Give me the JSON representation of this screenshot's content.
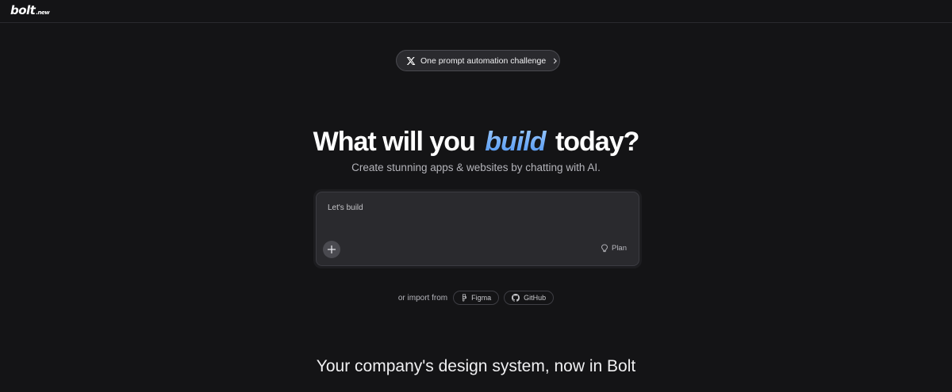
{
  "header": {
    "logo_text": "bolt",
    "logo_suffix": ".new"
  },
  "announcement": {
    "icon": "x-logo-icon",
    "label": "One prompt automation challenge",
    "chevron_icon": "chevron-right-icon"
  },
  "hero": {
    "title_before": "What will you",
    "title_accent": "build",
    "title_after": "today?",
    "subtitle": "Create stunning apps & websites by chatting with AI.",
    "accent_colors": [
      "#9ccaff",
      "#4f94f0"
    ]
  },
  "prompt": {
    "placeholder": "Let's build",
    "add_icon": "plus-icon",
    "plan_icon": "lightbulb-icon",
    "plan_label": "Plan"
  },
  "import": {
    "label": "or import from",
    "sources": [
      {
        "label": "Figma",
        "icon": "figma-icon"
      },
      {
        "label": "GitHub",
        "icon": "github-icon"
      }
    ]
  },
  "section": {
    "title": "Your company's design system, now in Bolt"
  }
}
